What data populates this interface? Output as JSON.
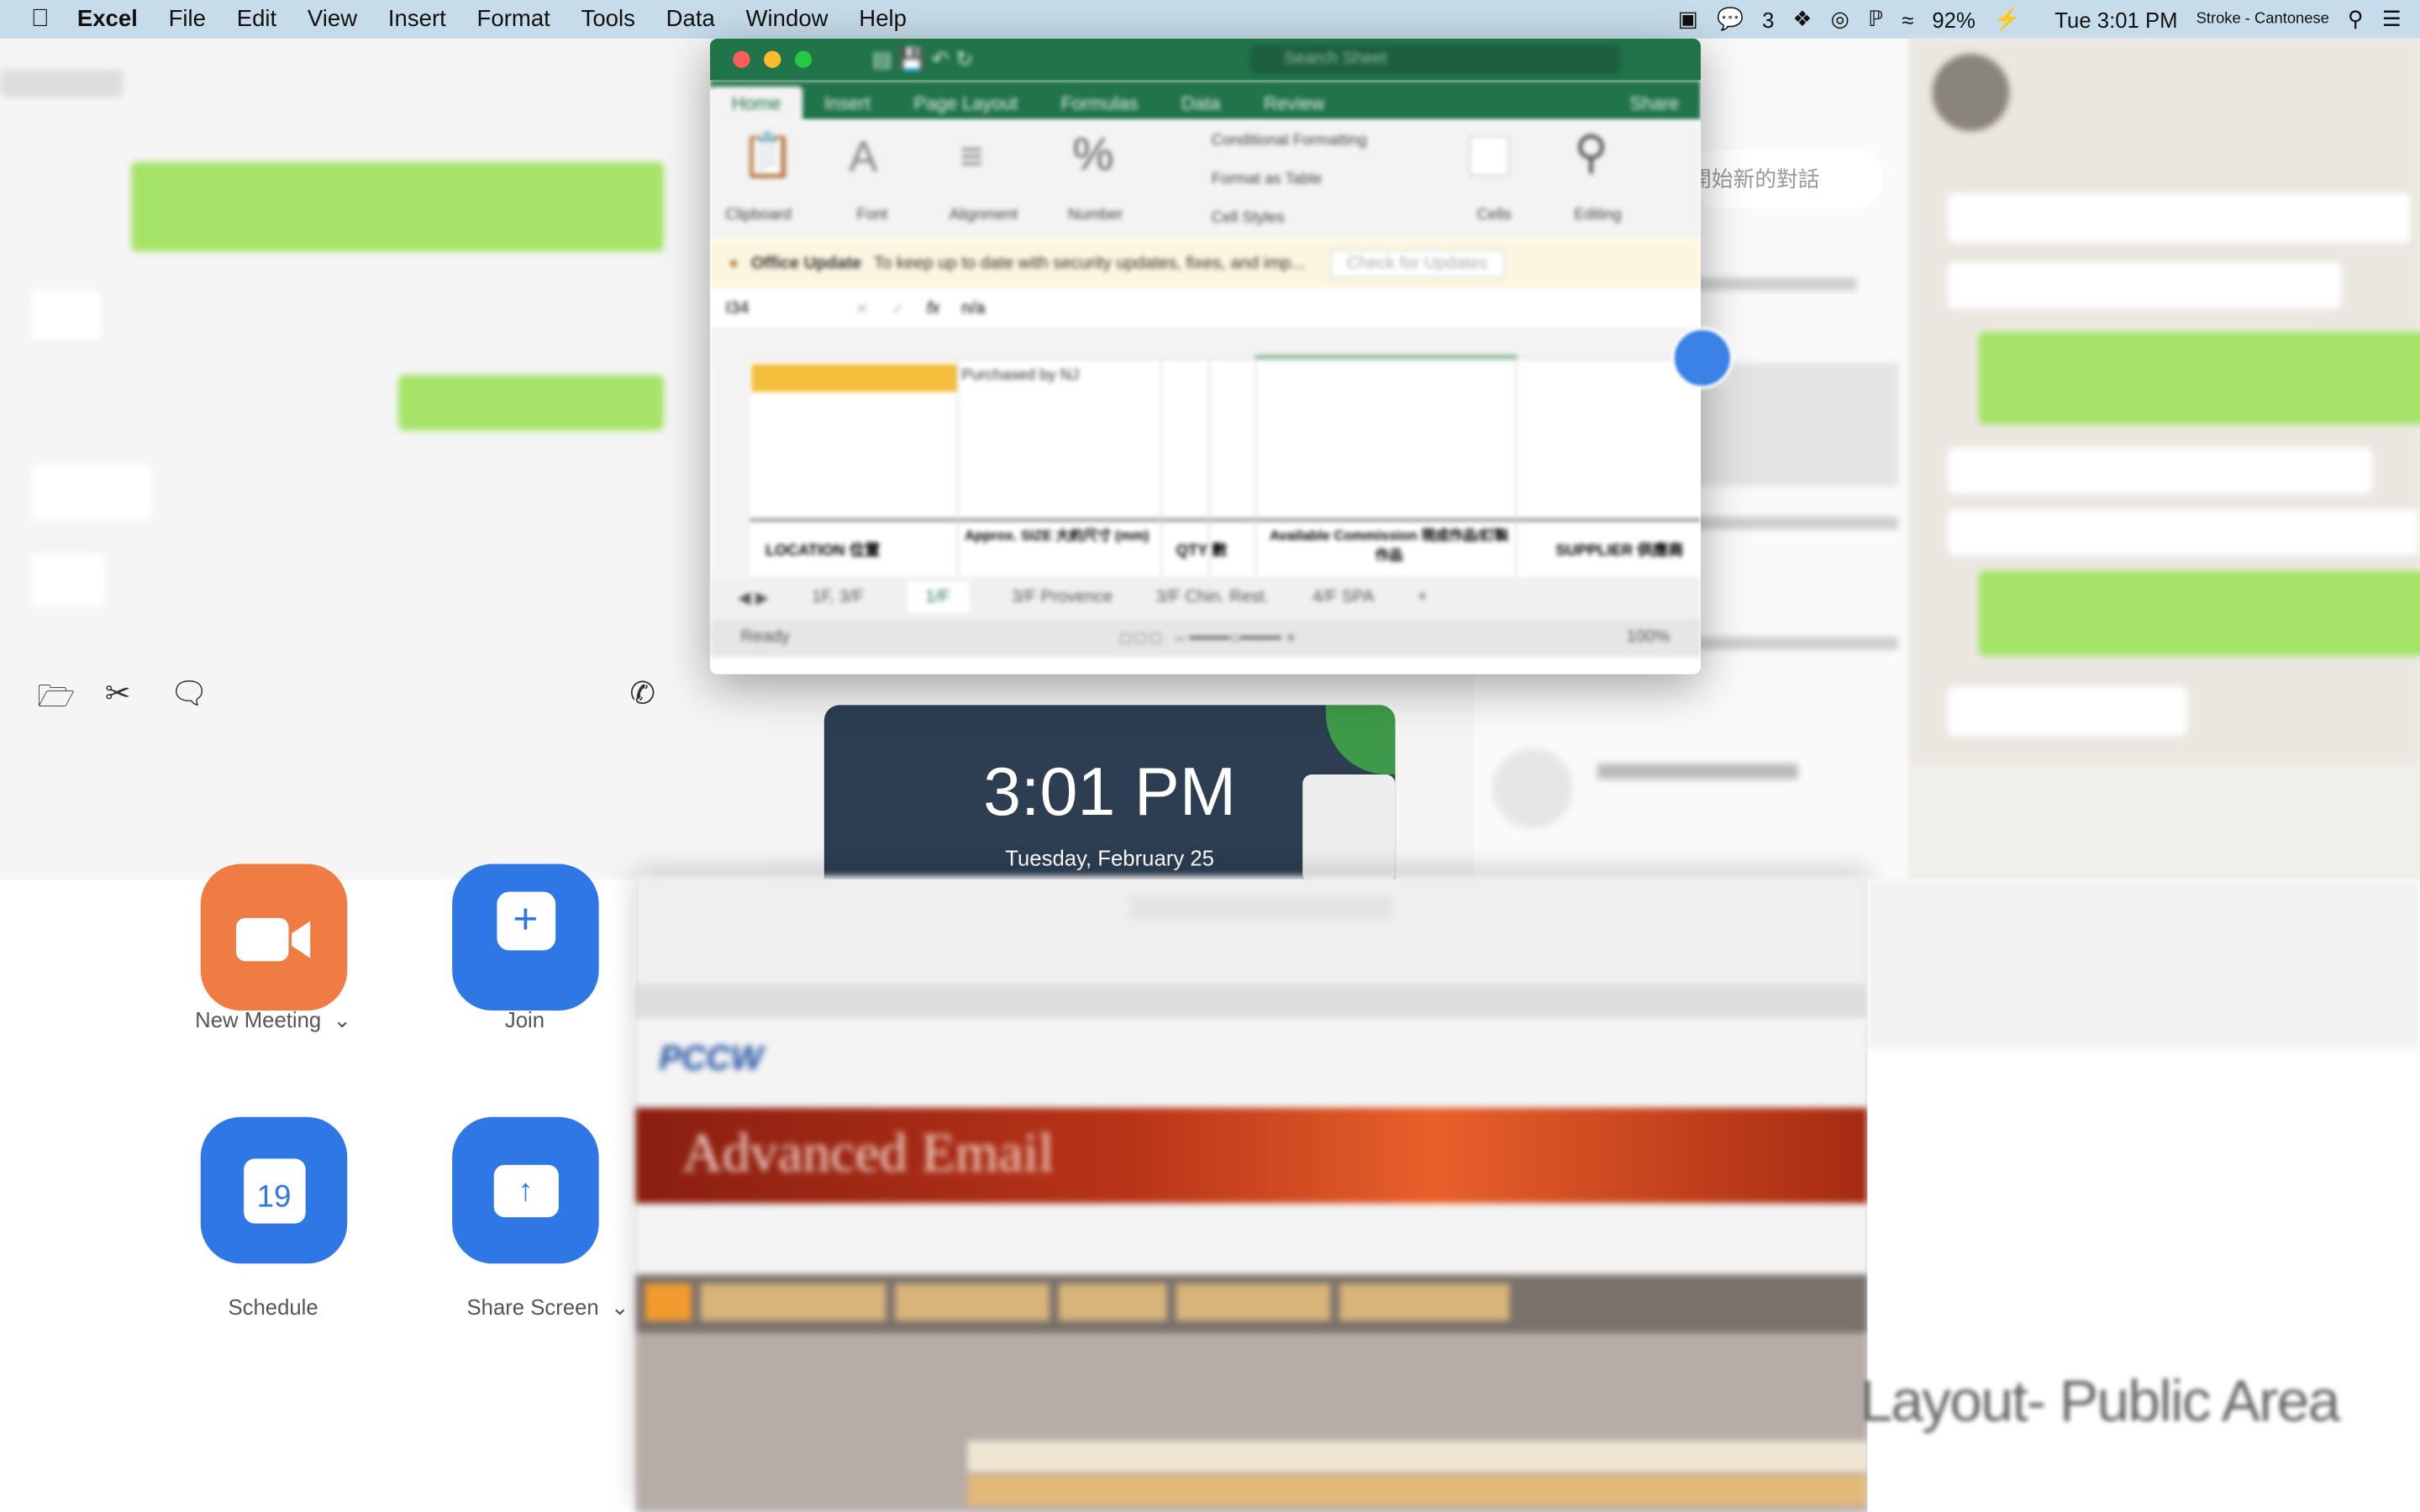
{
  "menubar": {
    "app": "Excel",
    "items": [
      "File",
      "Edit",
      "View",
      "Insert",
      "Format",
      "Tools",
      "Data",
      "Window",
      "Help"
    ],
    "wechat_count": "3",
    "battery": "92%",
    "clock": "Tue 3:01 PM",
    "input_method": "Stroke - Cantonese"
  },
  "excel": {
    "search_placeholder": "Search Sheet",
    "tabs": [
      "Home",
      "Insert",
      "Page Layout",
      "Formulas",
      "Data",
      "Review"
    ],
    "share": "Share",
    "groups": [
      "Clipboard",
      "Font",
      "Alignment",
      "Number",
      "Cells",
      "Editing"
    ],
    "styles": [
      "Conditional Formatting",
      "Format as Table",
      "Cell Styles"
    ],
    "update_title": "Office Update",
    "update_msg": "To keep up to date with security updates, fixes, and imp...",
    "update_btn": "Check for Updates",
    "name_box": "I34",
    "formula": "n/a",
    "cell_text": "Purchased by NJ",
    "headers": [
      "LOCATION 位置",
      "Approx. SIZE 大約尺寸 (mm)",
      "QTY 數",
      "Available Commission 現成作品/訂製作品",
      "SUPPLIER 供應商"
    ],
    "sheets": [
      "1F, 3/F",
      "1/F",
      "3/F Provence",
      "3/F Chin. Rest.",
      "4/F SPA"
    ],
    "status": "Ready",
    "zoom": "100%",
    "accent": "#21734a",
    "highlight": "#f4bd3c"
  },
  "chat": {
    "search_hint": "開始新的對話"
  },
  "clock_widget": {
    "time": "3:01 PM",
    "date": "Tuesday, February 25"
  },
  "zoom_app": {
    "buttons": [
      {
        "label": "New Meeting",
        "color": "#ef7d43"
      },
      {
        "label": "Join",
        "color": "#2e77e5"
      },
      {
        "label": "Schedule",
        "color": "#2e77e5",
        "day": "19"
      },
      {
        "label": "Share Screen",
        "color": "#2e77e5"
      }
    ]
  },
  "browser": {
    "logo": "PCCW",
    "banner": "Advanced Email"
  },
  "doc": {
    "heading": "Layout- Public Area"
  }
}
